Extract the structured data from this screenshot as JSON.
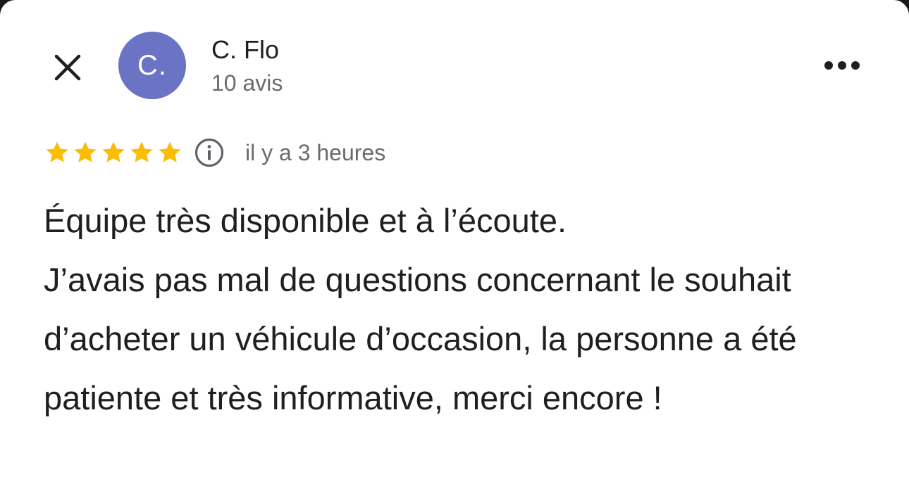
{
  "header": {
    "close_icon": "close-icon",
    "more_icon": "more-horizontal-icon"
  },
  "author": {
    "initials": "C.",
    "name": "C. Flo",
    "review_count": "10 avis",
    "avatar_color": "#6a73c4"
  },
  "rating": {
    "stars": 5,
    "max_stars": 5,
    "star_color": "#fbbc04",
    "info_icon": "info-icon",
    "time_ago": "il y a 3 heures"
  },
  "review": {
    "line1": "Équipe très disponible et à l’écoute.",
    "line2": "J’avais pas mal de questions concernant le souhait d’acheter un véhicule d’occasion, la personne a été patiente et très informative, merci encore !"
  }
}
